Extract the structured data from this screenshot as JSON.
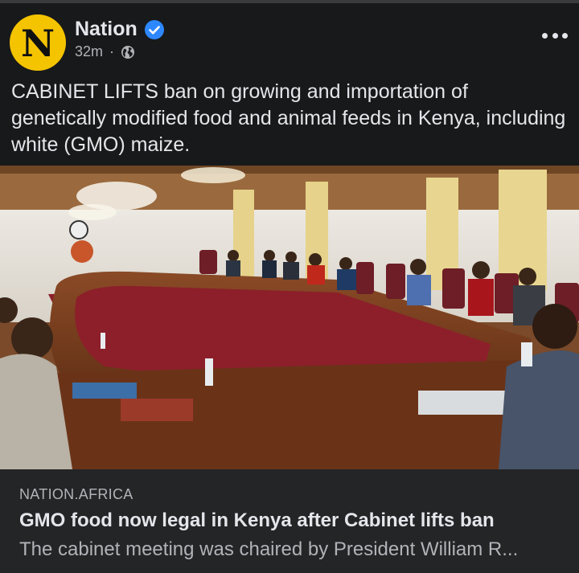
{
  "post": {
    "page_name": "Nation",
    "avatar_letter": "N",
    "time": "32m",
    "separator": "·",
    "visibility_icon": "globe-icon",
    "verified_icon": "verified-badge-icon",
    "text": "CABINET LIFTS ban on growing and importation of genetically modified food and animal feeds in Kenya, including white (GMO) maize."
  },
  "link_preview": {
    "domain": "NATION.AFRICA",
    "title": "GMO food now legal in Kenya after Cabinet lifts ban",
    "description": "The cabinet meeting was chaired by President William R..."
  },
  "colors": {
    "background": "#18191a",
    "card": "#242526",
    "text_primary": "#e4e6eb",
    "text_secondary": "#b0b3b8",
    "verified_blue": "#2d88ff",
    "avatar_yellow": "#f5c400"
  }
}
